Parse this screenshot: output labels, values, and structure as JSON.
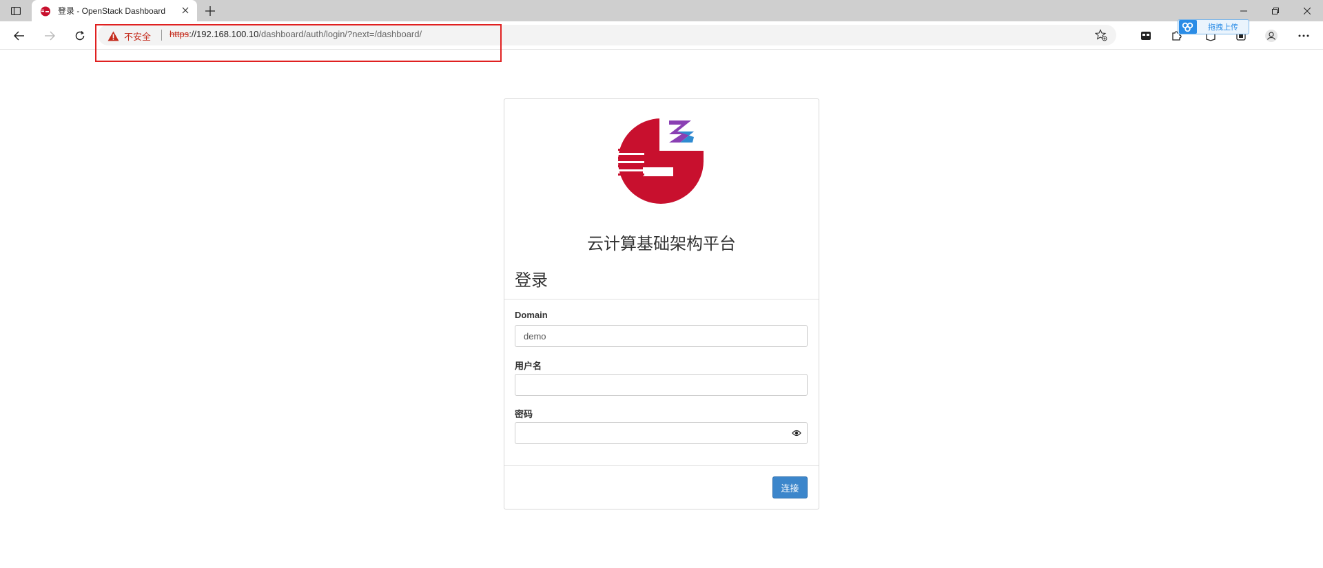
{
  "browser": {
    "tab": {
      "title": "登录 - OpenStack Dashboard"
    },
    "security_label": "不安全",
    "url": {
      "scheme": "https",
      "host": "://192.168.100.10",
      "path": "/dashboard/auth/login/?next=/dashboard/"
    },
    "extension": {
      "baidu_upload_label": "拖拽上传"
    }
  },
  "login": {
    "brand_title": "云计算基础架构平台",
    "heading": "登录",
    "domain": {
      "label": "Domain",
      "value": "demo"
    },
    "username": {
      "label": "用户名",
      "value": ""
    },
    "password": {
      "label": "密码",
      "value": ""
    },
    "submit_label": "连接"
  },
  "colors": {
    "logo_red": "#c8102e",
    "button_blue": "#3c86cb",
    "warning_red": "#c42b1c",
    "annotation_red": "#e02020"
  },
  "icons": [
    "tab-actions-icon",
    "openstack-favicon",
    "close-icon",
    "plus-icon",
    "back-arrow-icon",
    "forward-arrow-icon",
    "refresh-icon",
    "warning-icon",
    "favorite-star-icon",
    "collections-icon",
    "extensions-icon",
    "reading-icon",
    "screenshot-icon",
    "profile-icon",
    "more-icon",
    "cloud-icon",
    "eye-icon",
    "minimize-icon",
    "maximize-icon"
  ]
}
